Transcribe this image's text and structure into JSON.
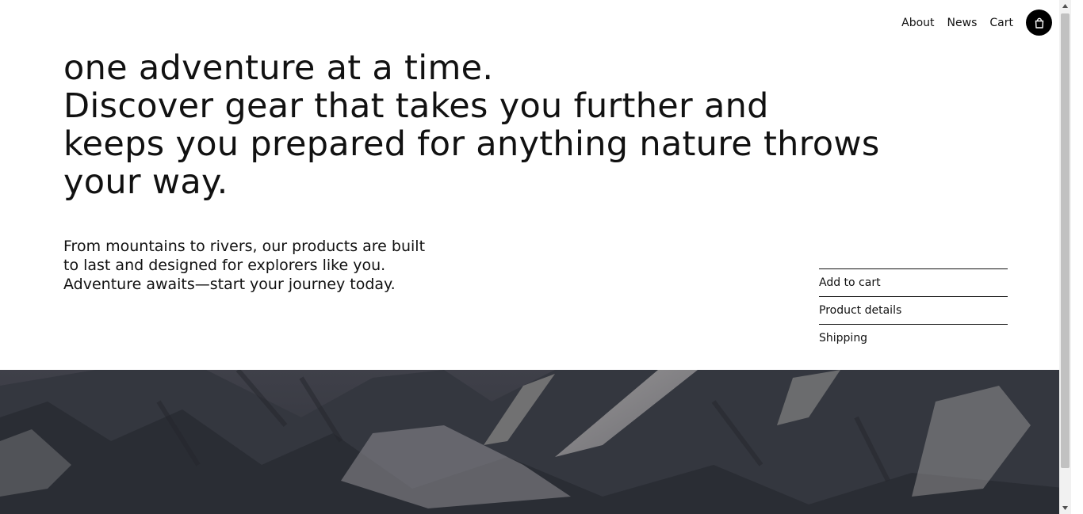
{
  "nav": {
    "about": "About",
    "news": "News",
    "cart": "Cart"
  },
  "hero": {
    "headline_lines": [
      "one adventure at a time.",
      "Discover gear that takes you further and",
      "keeps you prepared for anything nature throws",
      "your way."
    ],
    "sub_lines": [
      "From mountains to rivers, our products are built",
      "to last and designed for explorers like you.",
      "Adventure awaits—start your journey today."
    ]
  },
  "accordion": {
    "items": [
      "Add to cart",
      "Product details",
      "Shipping"
    ]
  },
  "icons": {
    "cart_button": "shopping-bag-icon",
    "scroll_up": "triangle-up-icon",
    "scroll_down": "triangle-down-icon"
  },
  "colors": {
    "background": "#ffffff",
    "text": "#111111",
    "cart_button": "#000000",
    "image_base": "#3a3d45"
  }
}
